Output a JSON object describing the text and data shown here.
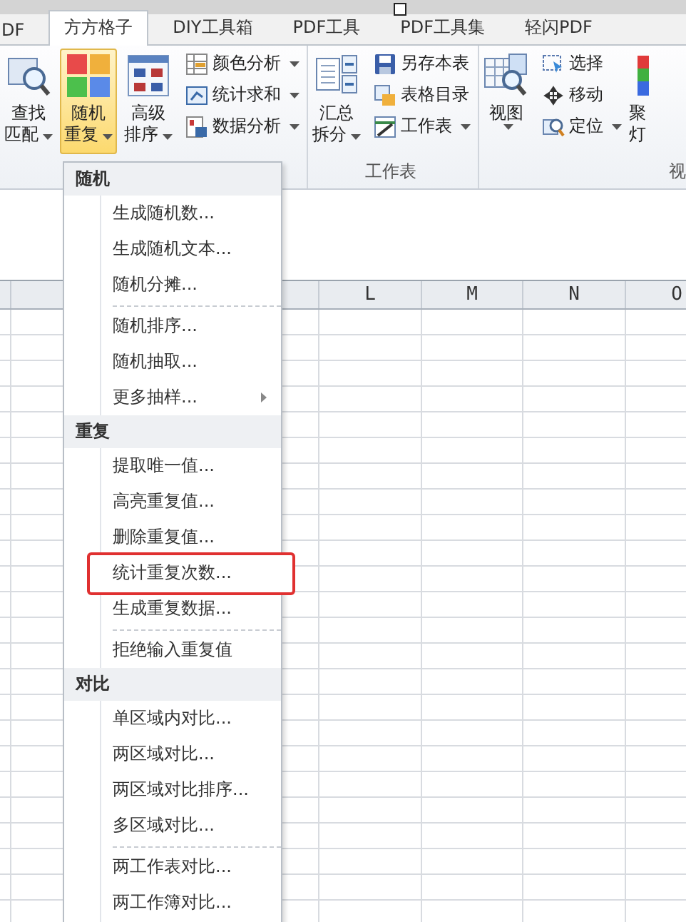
{
  "tabs": [
    {
      "label": "DF",
      "selected": false
    },
    {
      "label": "方方格子",
      "selected": true
    },
    {
      "label": "DIY工具箱",
      "selected": false
    },
    {
      "label": "PDF工具",
      "selected": false
    },
    {
      "label": "PDF工具集",
      "selected": false
    },
    {
      "label": "轻闪PDF",
      "selected": false
    }
  ],
  "ribbon": {
    "groups": [
      {
        "buttons": [
          {
            "kind": "large",
            "lines": [
              "查找",
              "匹配"
            ],
            "dropdown": true,
            "pressed": false
          },
          {
            "kind": "large",
            "lines": [
              "随机",
              "重复"
            ],
            "dropdown": true,
            "pressed": true
          },
          {
            "kind": "large",
            "lines": [
              "高级",
              "排序"
            ],
            "dropdown": true,
            "pressed": false
          },
          {
            "kind": "small",
            "lines": [
              "颜色分析"
            ],
            "dropdown": true,
            "pressed": false
          },
          {
            "kind": "small",
            "lines": [
              "统计求和"
            ],
            "dropdown": true,
            "pressed": false
          },
          {
            "kind": "small",
            "lines": [
              "数据分析"
            ],
            "dropdown": true,
            "pressed": false
          }
        ]
      },
      {
        "label": "工作表",
        "buttons": [
          {
            "kind": "large",
            "lines": [
              "汇总",
              "拆分"
            ],
            "dropdown": true,
            "pressed": false
          },
          {
            "kind": "small",
            "lines": [
              "另存本表"
            ],
            "dropdown": false,
            "pressed": false
          },
          {
            "kind": "small",
            "lines": [
              "表格目录"
            ],
            "dropdown": false,
            "pressed": false
          },
          {
            "kind": "small",
            "lines": [
              "工作表"
            ],
            "dropdown": true,
            "pressed": false
          }
        ]
      },
      {
        "label": "视",
        "buttons": [
          {
            "kind": "large",
            "lines": [
              "视图"
            ],
            "dropdown": true,
            "pressed": false
          },
          {
            "kind": "small",
            "lines": [
              "选择"
            ],
            "dropdown": false,
            "pressed": false
          },
          {
            "kind": "small",
            "lines": [
              "移动"
            ],
            "dropdown": false,
            "pressed": false
          },
          {
            "kind": "small",
            "lines": [
              "定位"
            ],
            "dropdown": true,
            "pressed": false
          },
          {
            "kind": "large",
            "lines": [
              "聚",
              "灯"
            ],
            "dropdown": false,
            "pressed": false
          }
        ]
      }
    ]
  },
  "menu": {
    "sections": [
      {
        "title": "随机",
        "items": [
          {
            "label": "生成随机数...",
            "separator_before": false,
            "submenu": false,
            "annotated": false
          },
          {
            "label": "生成随机文本...",
            "separator_before": false,
            "submenu": false,
            "annotated": false
          },
          {
            "label": "随机分摊...",
            "separator_before": false,
            "submenu": false,
            "annotated": false
          },
          {
            "label": "随机排序...",
            "separator_before": true,
            "submenu": false,
            "annotated": false
          },
          {
            "label": "随机抽取...",
            "separator_before": false,
            "submenu": false,
            "annotated": false
          },
          {
            "label": "更多抽样...",
            "separator_before": false,
            "submenu": true,
            "annotated": false
          }
        ]
      },
      {
        "title": "重复",
        "items": [
          {
            "label": "提取唯一值...",
            "separator_before": false,
            "submenu": false,
            "annotated": false
          },
          {
            "label": "高亮重复值...",
            "separator_before": false,
            "submenu": false,
            "annotated": false
          },
          {
            "label": "删除重复值...",
            "separator_before": false,
            "submenu": false,
            "annotated": false
          },
          {
            "label": "统计重复次数...",
            "separator_before": false,
            "submenu": false,
            "annotated": true
          },
          {
            "label": "生成重复数据...",
            "separator_before": false,
            "submenu": false,
            "annotated": false
          },
          {
            "label": "拒绝输入重复值",
            "separator_before": true,
            "submenu": false,
            "annotated": false
          }
        ]
      },
      {
        "title": "对比",
        "items": [
          {
            "label": "单区域内对比...",
            "separator_before": false,
            "submenu": false,
            "annotated": false
          },
          {
            "label": "两区域对比...",
            "separator_before": false,
            "submenu": false,
            "annotated": false
          },
          {
            "label": "两区域对比排序...",
            "separator_before": false,
            "submenu": false,
            "annotated": false
          },
          {
            "label": "多区域对比...",
            "separator_before": false,
            "submenu": false,
            "annotated": false
          },
          {
            "label": "两工作表对比...",
            "separator_before": true,
            "submenu": false,
            "annotated": false
          },
          {
            "label": "两工作簿对比...",
            "separator_before": false,
            "submenu": false,
            "annotated": false
          }
        ]
      }
    ]
  },
  "sheet": {
    "columns": [
      "L",
      "M",
      "N",
      "O"
    ]
  }
}
